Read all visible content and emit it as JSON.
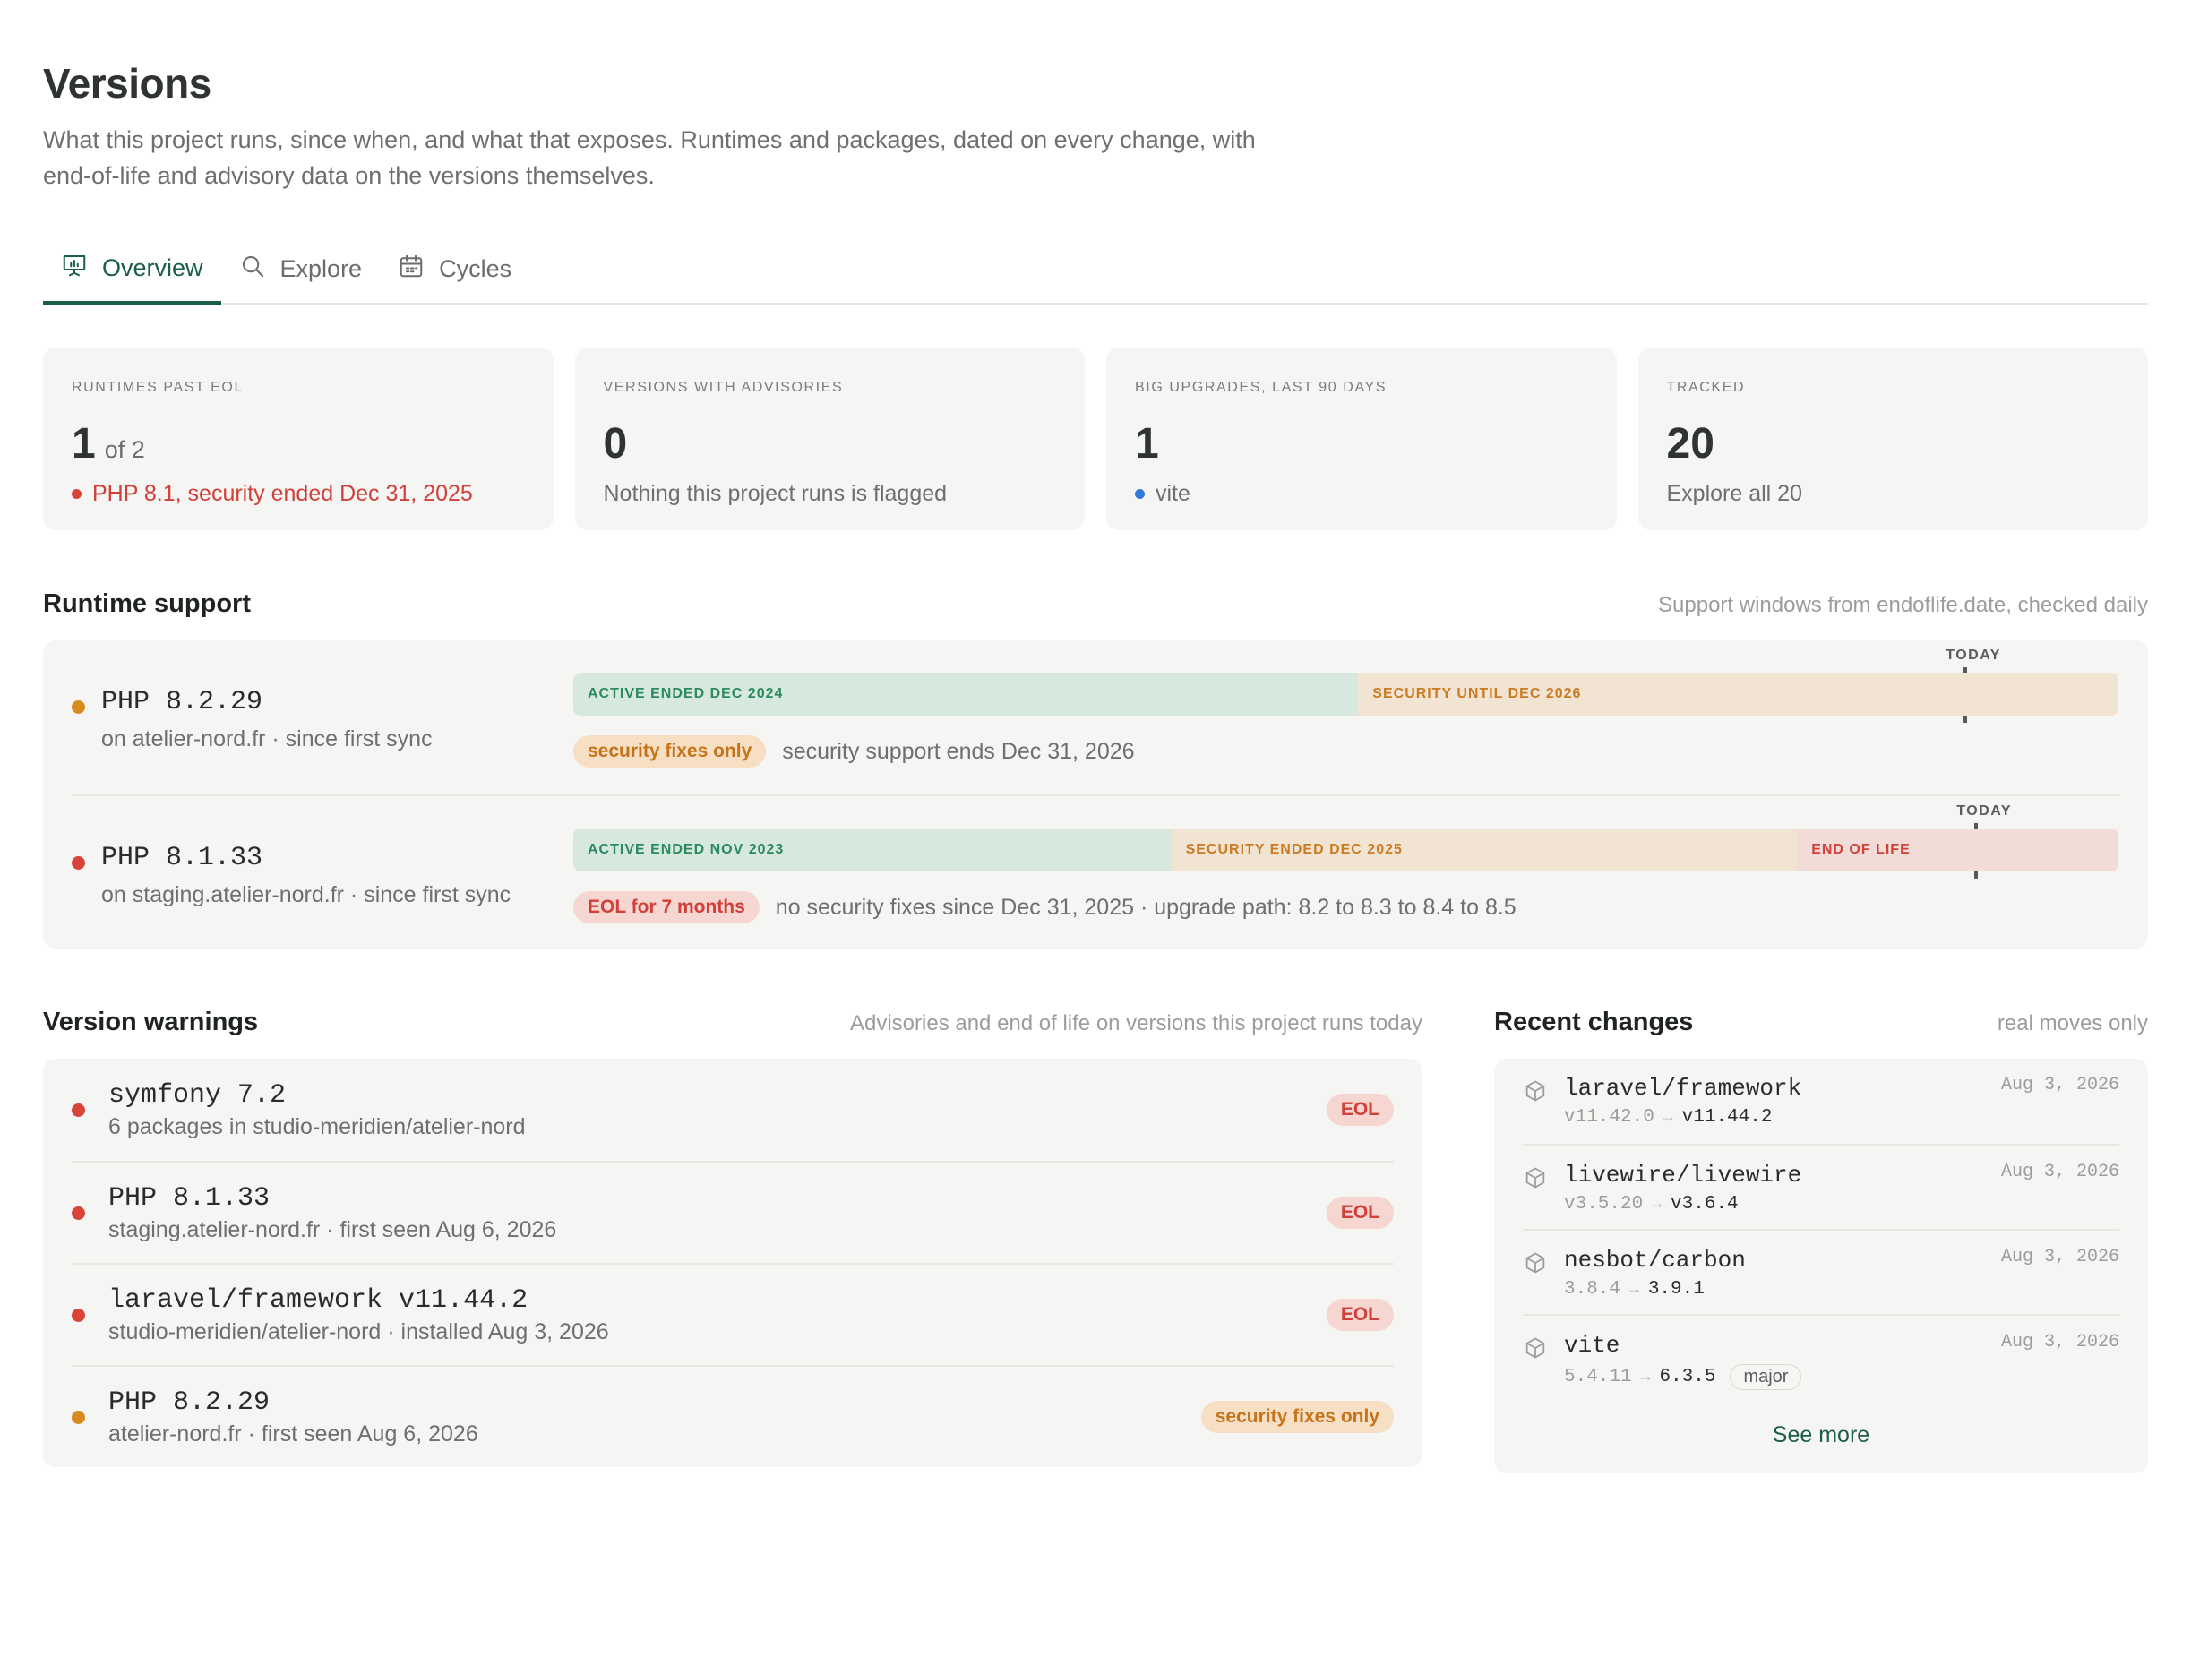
{
  "header": {
    "title": "Versions",
    "subtitle": "What this project runs, since when, and what that exposes. Runtimes and packages, dated on every change, with end-of-life and advisory data on the versions themselves."
  },
  "tabs": [
    {
      "label": "Overview",
      "icon": "presentation-icon",
      "active": true
    },
    {
      "label": "Explore",
      "icon": "search-icon",
      "active": false
    },
    {
      "label": "Cycles",
      "icon": "calendar-icon",
      "active": false
    }
  ],
  "cards": [
    {
      "label": "RUNTIMES PAST EOL",
      "value": "1",
      "value_suffix": "of 2",
      "sub": "PHP 8.1, security ended Dec 31, 2025",
      "sub_color": "red"
    },
    {
      "label": "VERSIONS WITH ADVISORIES",
      "value": "0",
      "value_suffix": "",
      "sub": "Nothing this project runs is flagged"
    },
    {
      "label": "BIG UPGRADES, LAST 90 DAYS",
      "value": "1",
      "value_suffix": "",
      "sub": "vite",
      "sub_dot": "blue"
    },
    {
      "label": "TRACKED",
      "value": "20",
      "value_suffix": "",
      "sub": "Explore all 20"
    }
  ],
  "runtime": {
    "title": "Runtime support",
    "note": "Support windows from endoflife.date, checked daily",
    "today_label": "TODAY",
    "rows": [
      {
        "name": "PHP 8.2.29",
        "sub": "on atelier-nord.fr · since first sync",
        "status": "orange",
        "segments": [
          {
            "label": "ACTIVE ENDED DEC 2024",
            "kind": "active",
            "share": 0.508
          },
          {
            "label": "SECURITY UNTIL DEC 2026",
            "kind": "security",
            "share": 0.492
          }
        ],
        "today_position": 0.901,
        "pill": "security fixes only",
        "pill_color": "orange",
        "meta": "security support ends Dec 31, 2026"
      },
      {
        "name": "PHP 8.1.33",
        "sub": "on staging.atelier-nord.fr · since first sync",
        "status": "red",
        "segments": [
          {
            "label": "ACTIVE ENDED NOV 2023",
            "kind": "active",
            "share": 0.387
          },
          {
            "label": "SECURITY ENDED DEC 2025",
            "kind": "security",
            "share": 0.405
          },
          {
            "label": "END OF LIFE",
            "kind": "eol",
            "share": 0.208
          }
        ],
        "today_position": 0.908,
        "pill": "EOL for 7 months",
        "pill_color": "red",
        "meta": "no security fixes since Dec 31, 2025 · upgrade path: 8.2 to 8.3 to 8.4 to 8.5"
      }
    ]
  },
  "warnings": {
    "title": "Version warnings",
    "note": "Advisories and end of life on versions this project runs today",
    "items": [
      {
        "name": "symfony 7.2",
        "sub": "6 packages in studio-meridien/atelier-nord",
        "badge": "EOL",
        "color": "red"
      },
      {
        "name": "PHP 8.1.33",
        "sub": "staging.atelier-nord.fr · first seen Aug 6, 2026",
        "badge": "EOL",
        "color": "red"
      },
      {
        "name": "laravel/framework v11.44.2",
        "sub": "studio-meridien/atelier-nord · installed Aug 3, 2026",
        "badge": "EOL",
        "color": "red"
      },
      {
        "name": "PHP 8.2.29",
        "sub": "atelier-nord.fr · first seen Aug 6, 2026",
        "badge": "security fixes only",
        "color": "orange"
      }
    ]
  },
  "recent": {
    "title": "Recent changes",
    "note": "real moves only",
    "items": [
      {
        "name": "laravel/framework",
        "from": "v11.42.0",
        "to": "v11.44.2",
        "date": "Aug 3, 2026",
        "tag": ""
      },
      {
        "name": "livewire/livewire",
        "from": "v3.5.20",
        "to": "v3.6.4",
        "date": "Aug 3, 2026",
        "tag": ""
      },
      {
        "name": "nesbot/carbon",
        "from": "3.8.4",
        "to": "3.9.1",
        "date": "Aug 3, 2026",
        "tag": ""
      },
      {
        "name": "vite",
        "from": "5.4.11",
        "to": "6.3.5",
        "date": "Aug 3, 2026",
        "tag": "major"
      }
    ],
    "arrow": "→",
    "see_more": "See more"
  },
  "colors": {
    "accent": "#1b5e47",
    "red": "#d9443a",
    "orange": "#d88a20",
    "blue": "#2f7ad6"
  }
}
